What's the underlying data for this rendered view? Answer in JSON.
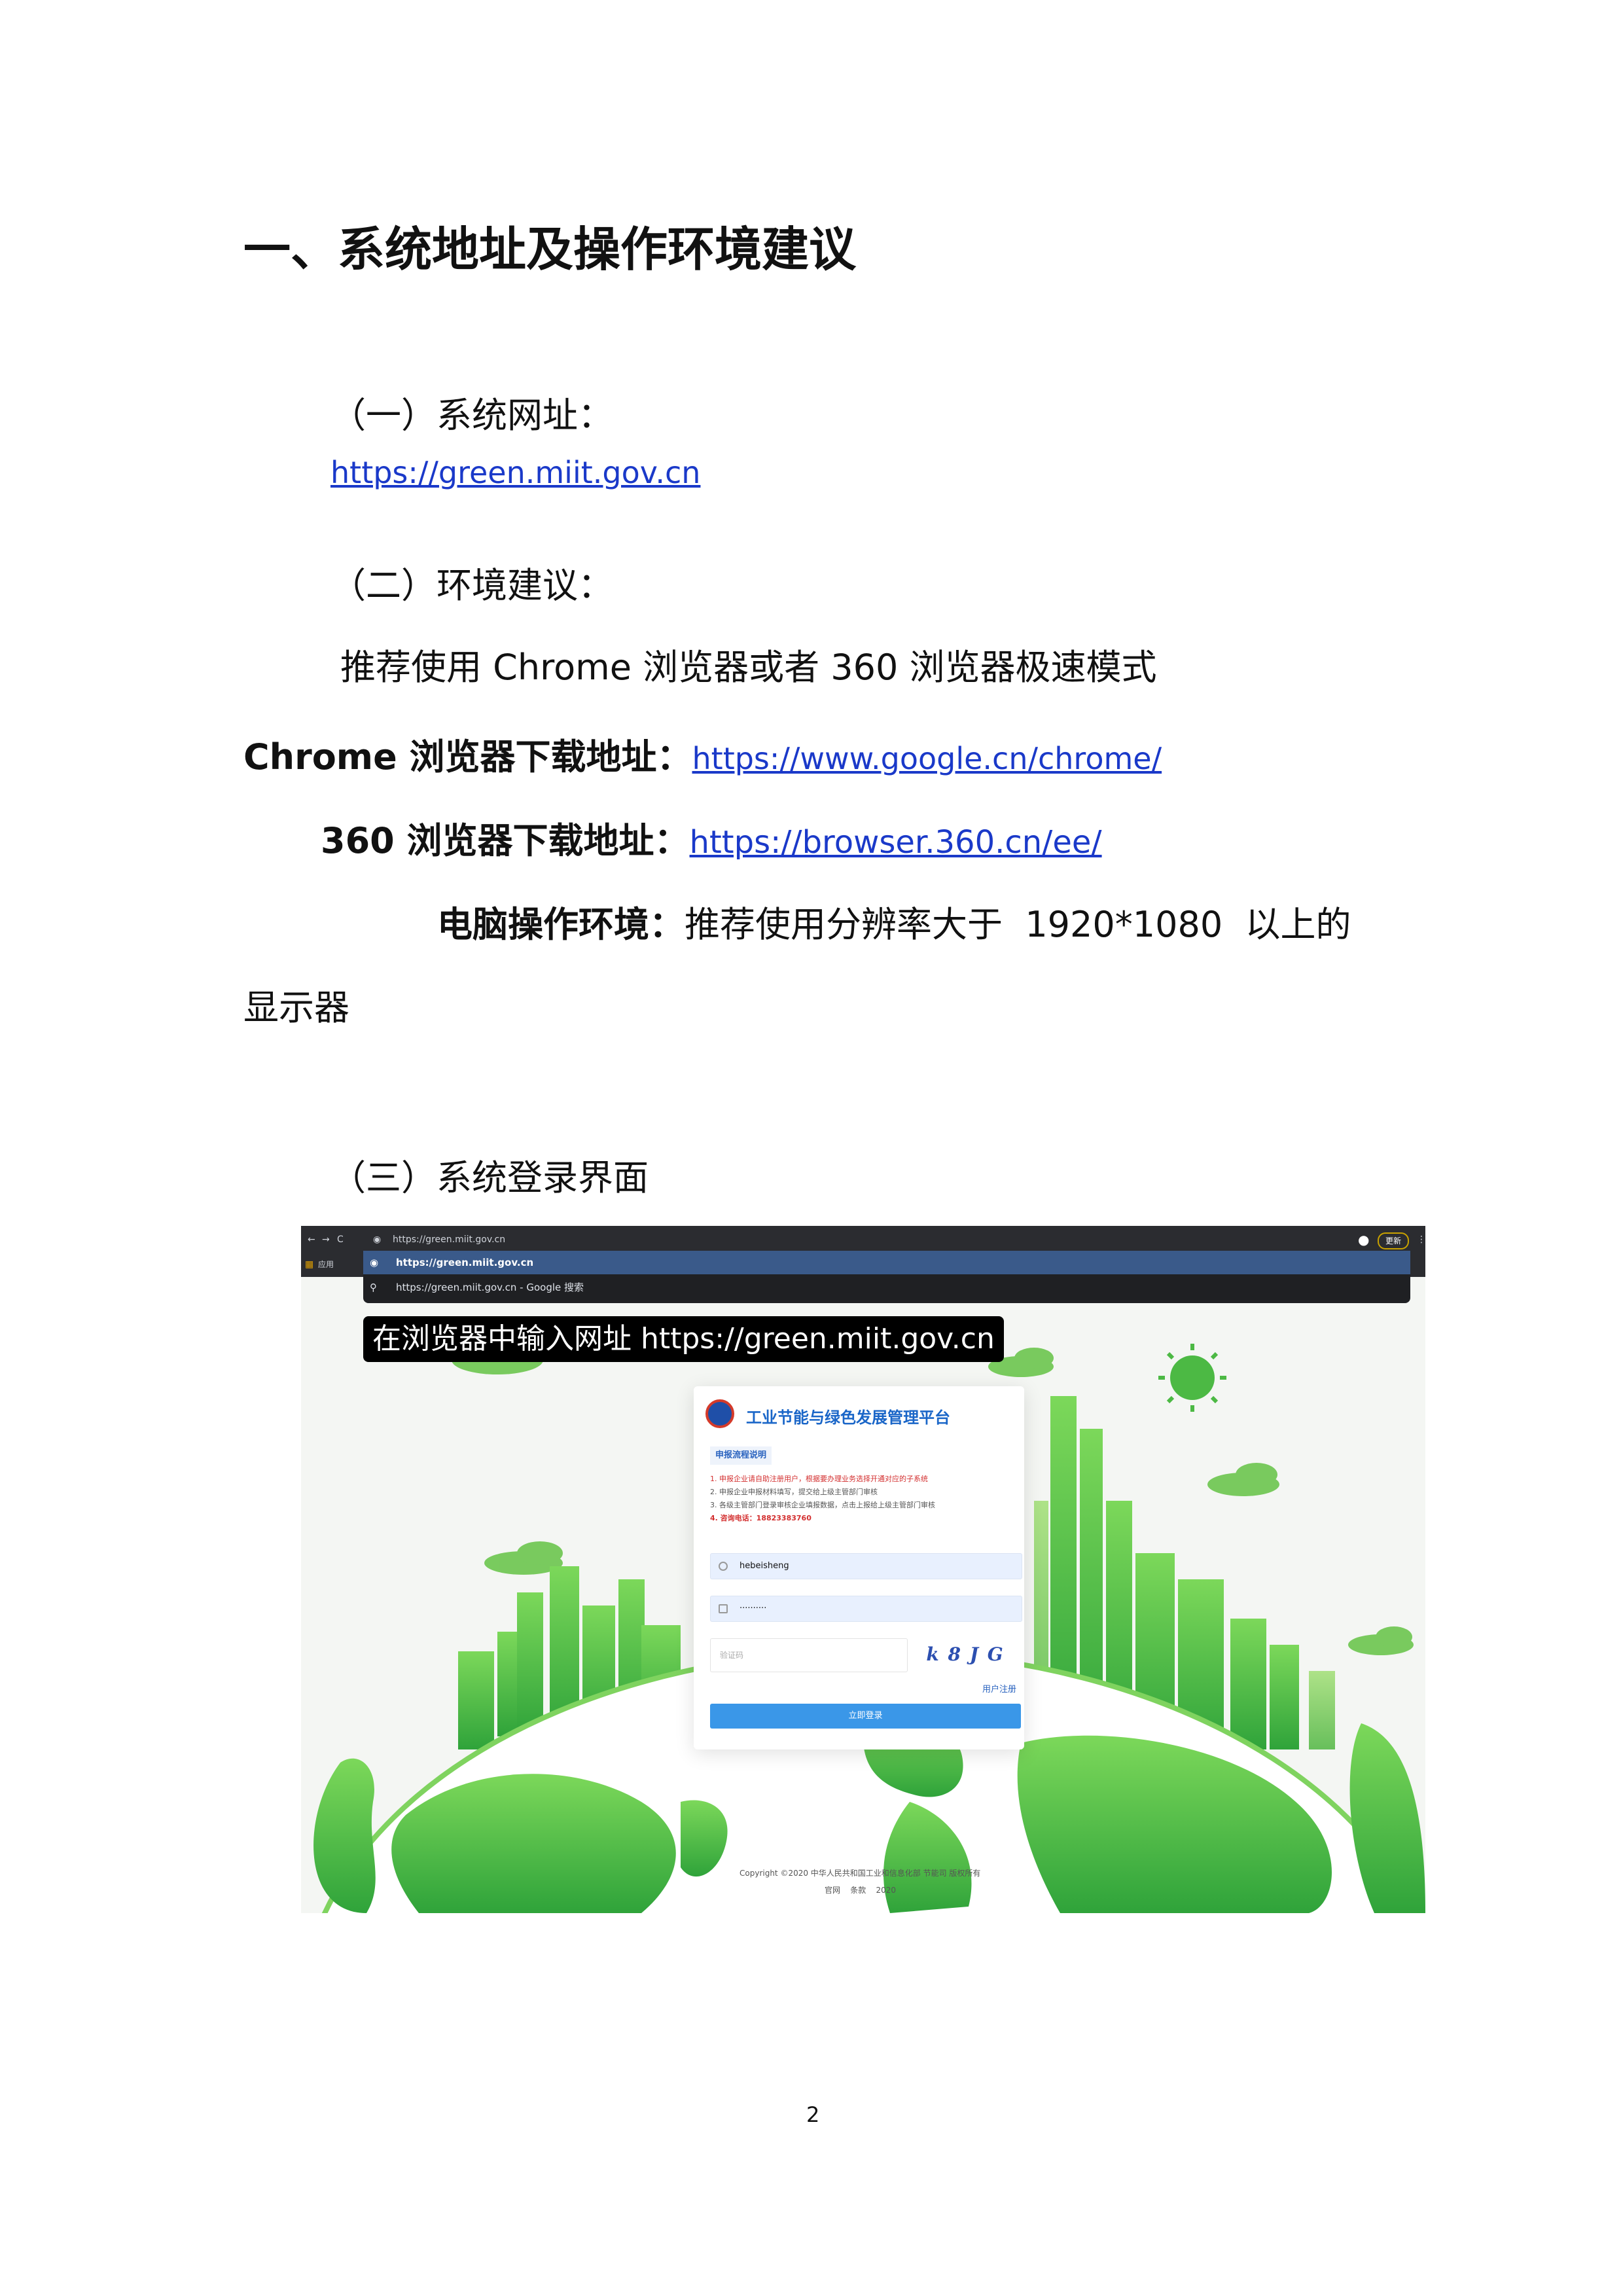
{
  "heading": "一、系统地址及操作环境建议",
  "sections": {
    "s1_title": "（一）系统网址：",
    "s1_url": "https://green.miit.gov.cn",
    "s2_title": "（二）环境建议：",
    "s2_recommend": "推荐使用 Chrome 浏览器或者 360 浏览器极速模式",
    "chrome_label": "Chrome 浏览器下载地址：",
    "chrome_url": "https://www.google.cn/chrome/",
    "b360_label": "360 浏览器下载地址：",
    "b360_url": "https://browser.360.cn/ee/",
    "pc_label": "电脑操作环境：",
    "pc_text": "推荐使用分辨率大于  1920*1080  以上的",
    "pc_text_cont": "显示器",
    "s3_title": "（三）系统登录界面"
  },
  "screenshot": {
    "address": "https://green.miit.gov.cn",
    "suggest_1": "https://green.miit.gov.cn",
    "suggest_2": "https://green.miit.gov.cn - Google 搜索",
    "apps_label": "应用",
    "update_label": "更新",
    "caption": "在浏览器中输入网址 https://green.miit.gov.cn",
    "card": {
      "title": "工业节能与绿色发展管理平台",
      "tab": "申报流程说明",
      "steps": [
        "1. 申报企业请自助注册用户，根据要办理业务选择开通对应的子系统",
        "2. 申报企业申报材料填写，提交给上级主管部门审核",
        "3. 各级主管部门登录审核企业填报数据，点击上报给上级主管部门审核",
        "4. 咨询电话：18823383760"
      ],
      "username": "hebeisheng",
      "password": "··········",
      "captcha_placeholder": "验证码",
      "captcha_text": "k 8 J G",
      "register": "用户注册",
      "login": "立即登录"
    },
    "footer_1": "Copyright ©2020 中华人民共和国工业和信息化部 节能司 版权所有",
    "footer_2": "官网    条款    2020"
  },
  "page_number": "2"
}
